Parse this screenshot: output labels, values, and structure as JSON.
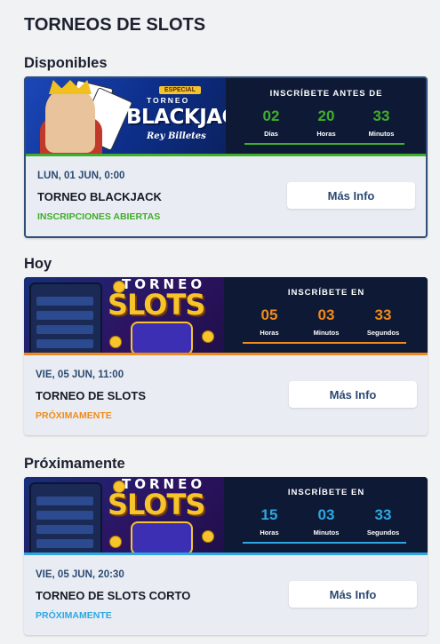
{
  "page": {
    "title": "TORNEOS DE SLOTS"
  },
  "sections": [
    {
      "title": "Disponibles",
      "card": {
        "selected": true,
        "banner": {
          "art": {
            "tag": "ESPECIAL",
            "torneo": "TORNEO",
            "headline": "BLACKJACK",
            "signature": "Rey Billetes"
          },
          "countdown_title": "INSCRÍBETE ANTES DE",
          "units": [
            {
              "value": "02",
              "label": "Días"
            },
            {
              "value": "20",
              "label": "Horas"
            },
            {
              "value": "33",
              "label": "Minutos"
            }
          ],
          "accent_color": "#3fae2a"
        },
        "date": "LUN, 01 JUN, 0:00",
        "name": "TORNEO BLACKJACK",
        "status": "INSCRIPCIONES ABIERTAS",
        "status_color": "#3fae2a",
        "button_label": "Más Info"
      }
    },
    {
      "title": "Hoy",
      "card": {
        "selected": false,
        "banner": {
          "art": {
            "torneo": "TORNEO",
            "headline": "SLOTS"
          },
          "countdown_title": "INSCRÍBETE EN",
          "units": [
            {
              "value": "05",
              "label": "Horas"
            },
            {
              "value": "03",
              "label": "Minutos"
            },
            {
              "value": "33",
              "label": "Segundos"
            }
          ],
          "accent_color": "#f08a1c"
        },
        "date": "VIE, 05 JUN, 11:00",
        "name": "TORNEO DE SLOTS",
        "status": "PRÓXIMAMENTE",
        "status_color": "#f08a1c",
        "button_label": "Más Info"
      }
    },
    {
      "title": "Próximamente",
      "card": {
        "selected": false,
        "banner": {
          "art": {
            "torneo": "TORNEO",
            "headline": "SLOTS"
          },
          "countdown_title": "INSCRÍBETE EN",
          "units": [
            {
              "value": "15",
              "label": "Horas"
            },
            {
              "value": "03",
              "label": "Minutos"
            },
            {
              "value": "33",
              "label": "Segundos"
            }
          ],
          "accent_color": "#2ea7e0"
        },
        "date": "VIE, 05 JUN, 20:30",
        "name": "TORNEO DE SLOTS CORTO",
        "status": "PRÓXIMAMENTE",
        "status_color": "#2ea7e0",
        "button_label": "Más Info"
      }
    }
  ]
}
